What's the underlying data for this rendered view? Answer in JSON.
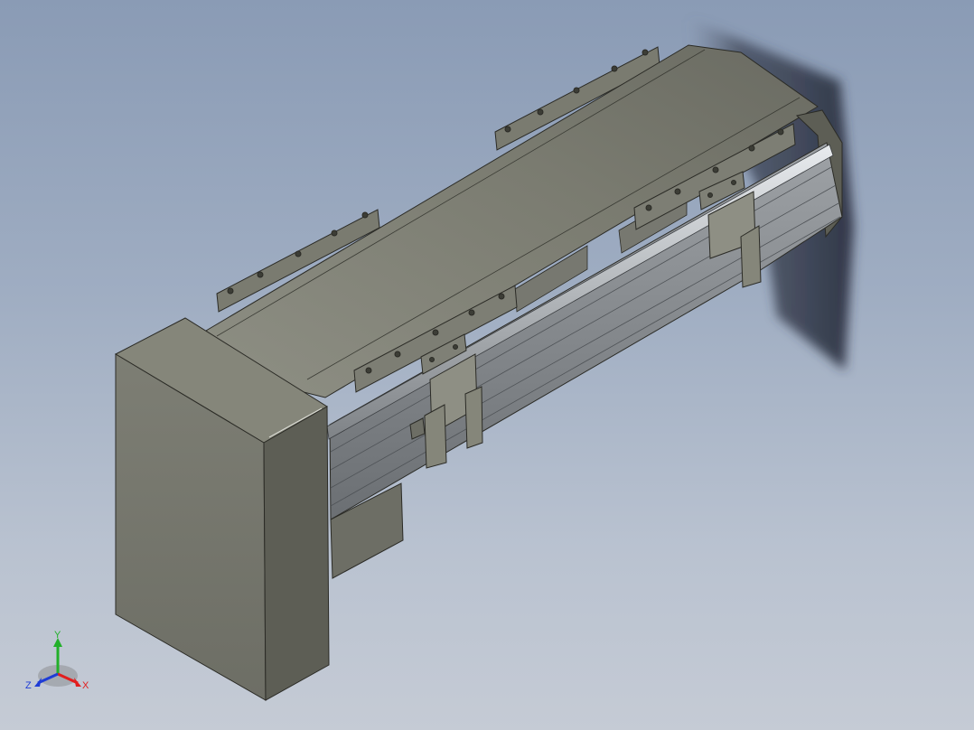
{
  "viewport": {
    "background_top": "#8a9bb5",
    "background_bottom": "#c5cbd5"
  },
  "model": {
    "body_color": "#85867a",
    "body_dark": "#5d5e55",
    "rail_color": "#b9bcbf",
    "shadow_color": "#2a3040"
  },
  "triad": {
    "x_label": "X",
    "y_label": "Y",
    "z_label": "Z",
    "x_color": "#e21e1e",
    "y_color": "#22b02a",
    "z_color": "#1e3cd6"
  }
}
